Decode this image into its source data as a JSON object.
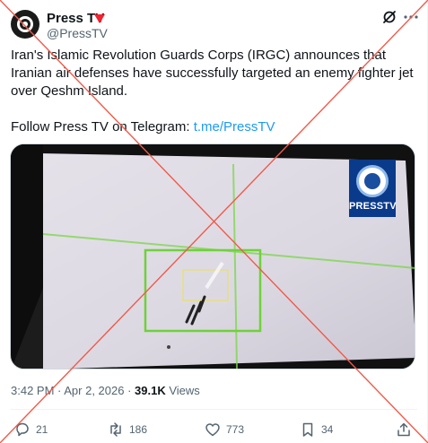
{
  "author": {
    "display_name": "Press TV",
    "handle": "@PressTV",
    "avatar_icon": "presstv-avatar",
    "badge_icon": "heart-badge-icon",
    "badge_color": "#f4212e"
  },
  "header": {
    "grok_icon": "grok-icon",
    "more_icon": "more-icon"
  },
  "tweet": {
    "text": "Iran's Islamic Revolution Guards Corps (IRGC) announces that Iranian air defenses have successfully targeted an enemy fighter jet over Qeshm Island.",
    "follow_prefix": "Follow Press TV on Telegram: ",
    "follow_link": "t.me/PressTV",
    "link_color": "#1d9bf0"
  },
  "media": {
    "logo_text": "PRESSTV",
    "logo_icon": "presstv-globe-icon",
    "reticle_color": "#6fd13a"
  },
  "meta": {
    "time": "3:42 PM",
    "separator": " · ",
    "date": "Apr 2, 2026",
    "views_count": "39.1K",
    "views_label": " Views"
  },
  "actions": {
    "reply": {
      "icon": "reply-icon",
      "count": "21"
    },
    "repost": {
      "icon": "repost-icon",
      "count": "186"
    },
    "like": {
      "icon": "heart-icon",
      "count": "773"
    },
    "bookmark": {
      "icon": "bookmark-icon",
      "count": "34"
    },
    "share": {
      "icon": "share-icon"
    }
  },
  "overlay": {
    "cross_color": "#ef5a4a"
  }
}
